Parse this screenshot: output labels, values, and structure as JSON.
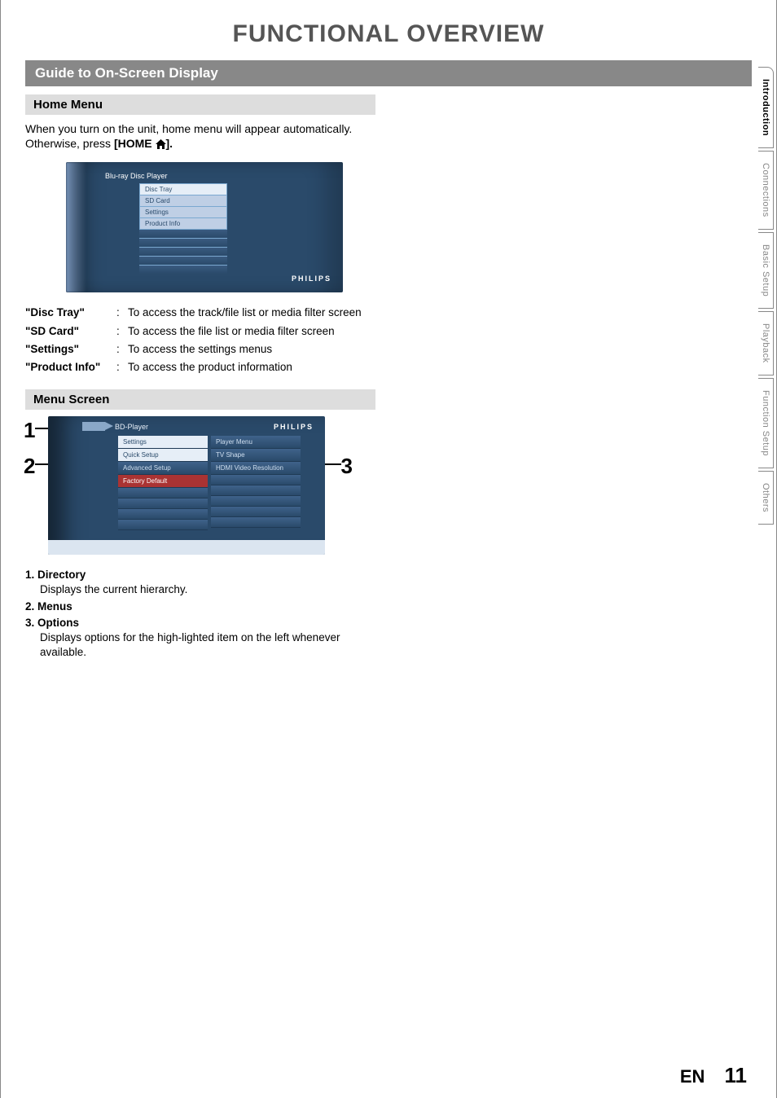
{
  "page_title": "FUNCTIONAL OVERVIEW",
  "section_title": "Guide to On-Screen Display",
  "home_menu": {
    "heading": "Home Menu",
    "intro_prefix": "When you turn on the unit, home menu will appear automatically. Otherwise, press ",
    "intro_bold": "[HOME ",
    "intro_suffix": "].",
    "figure": {
      "title": "Blu-ray Disc Player",
      "items": [
        "Disc Tray",
        "SD Card",
        "Settings",
        "Product Info"
      ],
      "brand": "PHILIPS"
    },
    "defs": [
      {
        "term": "\"Disc Tray\"",
        "desc": "To access the track/file list or media filter screen"
      },
      {
        "term": "\"SD Card\"",
        "desc": "To access the file list or media filter screen"
      },
      {
        "term": "\"Settings\"",
        "desc": "To access the settings menus"
      },
      {
        "term": "\"Product Info\"",
        "desc": "To access the product information"
      }
    ]
  },
  "menu_screen": {
    "heading": "Menu Screen",
    "figure": {
      "breadcrumb": "BD-Player",
      "brand": "PHILIPS",
      "left_col": [
        "Settings",
        "Quick Setup",
        "Advanced Setup",
        "Factory Default"
      ],
      "right_col": [
        "Player Menu",
        "TV Shape",
        "HDMI Video Resolution"
      ],
      "callouts": {
        "c1": "1",
        "c2": "2",
        "c3": "3"
      }
    },
    "list": [
      {
        "num": "1.",
        "label": "Directory",
        "desc": "Displays the current hierarchy."
      },
      {
        "num": "2.",
        "label": "Menus",
        "desc": ""
      },
      {
        "num": "3.",
        "label": "Options",
        "desc": "Displays options for the high-lighted item on the left whenever available."
      }
    ]
  },
  "tabs": [
    "Introduction",
    "Connections",
    "Basic Setup",
    "Playback",
    "Function Setup",
    "Others"
  ],
  "footer": {
    "lang": "EN",
    "page": "11"
  }
}
